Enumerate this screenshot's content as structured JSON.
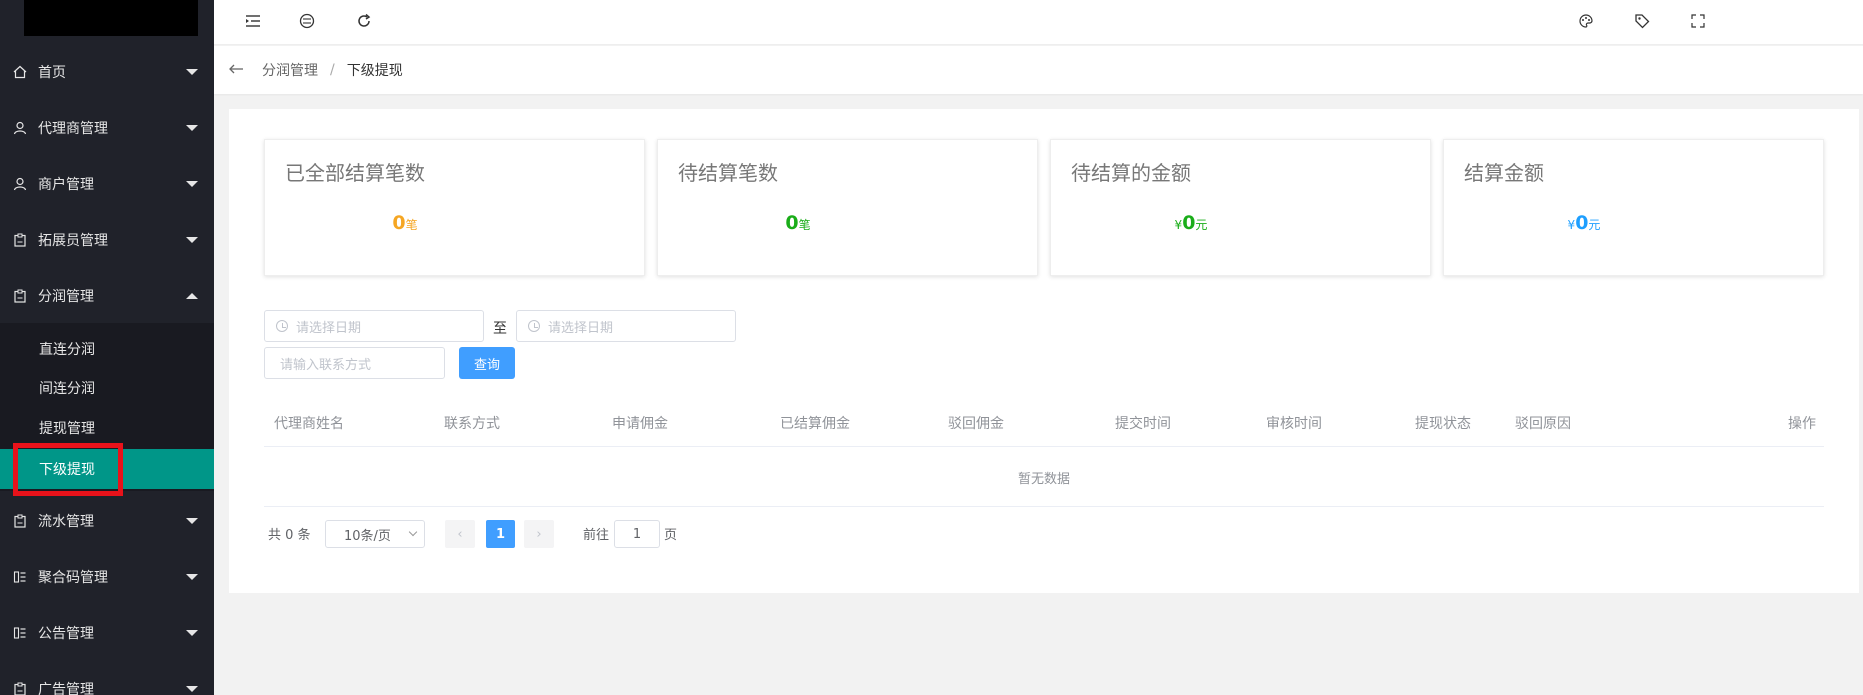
{
  "sidebar": {
    "menu": [
      {
        "label": "首页",
        "icon": "home-icon"
      },
      {
        "label": "代理商管理",
        "icon": "user-icon"
      },
      {
        "label": "商户管理",
        "icon": "user-icon"
      },
      {
        "label": "拓展员管理",
        "icon": "clipboard-icon"
      },
      {
        "label": "分润管理",
        "icon": "clipboard-icon"
      },
      {
        "label": "流水管理",
        "icon": "clipboard-icon"
      },
      {
        "label": "聚合码管理",
        "icon": "list-icon"
      },
      {
        "label": "公告管理",
        "icon": "list-icon"
      },
      {
        "label": "广告管理",
        "icon": "clipboard-icon"
      }
    ],
    "submenu": [
      {
        "label": "直连分润"
      },
      {
        "label": "间连分润"
      },
      {
        "label": "提现管理"
      },
      {
        "label": "下级提现"
      }
    ]
  },
  "breadcrumb": {
    "parent": "分润管理",
    "separator": "/",
    "current": "下级提现"
  },
  "stats": [
    {
      "title": "已全部结算笔数",
      "prefix": "",
      "value": "0",
      "unit": "笔",
      "color": "#f5a623"
    },
    {
      "title": "待结算笔数",
      "prefix": "",
      "value": "0",
      "unit": "笔",
      "color": "#1aad19"
    },
    {
      "title": "待结算的金额",
      "prefix": "¥",
      "value": "0",
      "unit": "元",
      "color": "#1aad19"
    },
    {
      "title": "结算金额",
      "prefix": "¥",
      "value": "0",
      "unit": "元",
      "color": "#1e9fff"
    }
  ],
  "filters": {
    "start_date_placeholder": "请选择日期",
    "to_label": "至",
    "end_date_placeholder": "请选择日期",
    "contact_placeholder": "请输入联系方式",
    "query_label": "查询"
  },
  "table": {
    "headers": [
      "代理商姓名",
      "联系方式",
      "申请佣金",
      "已结算佣金",
      "驳回佣金",
      "提交时间",
      "审核时间",
      "提现状态",
      "驳回原因",
      "操作"
    ],
    "empty_text": "暂无数据"
  },
  "pagination": {
    "total": "共 0 条",
    "page_size": "10条/页",
    "prev": "‹",
    "current": "1",
    "next": "›",
    "goto_label": "前往",
    "goto_value": "1",
    "goto_unit": "页"
  },
  "colors": {
    "sidebar_bg": "#20222a",
    "active_menu": "#009688",
    "primary": "#409eff",
    "highlight": "#e8121a"
  }
}
